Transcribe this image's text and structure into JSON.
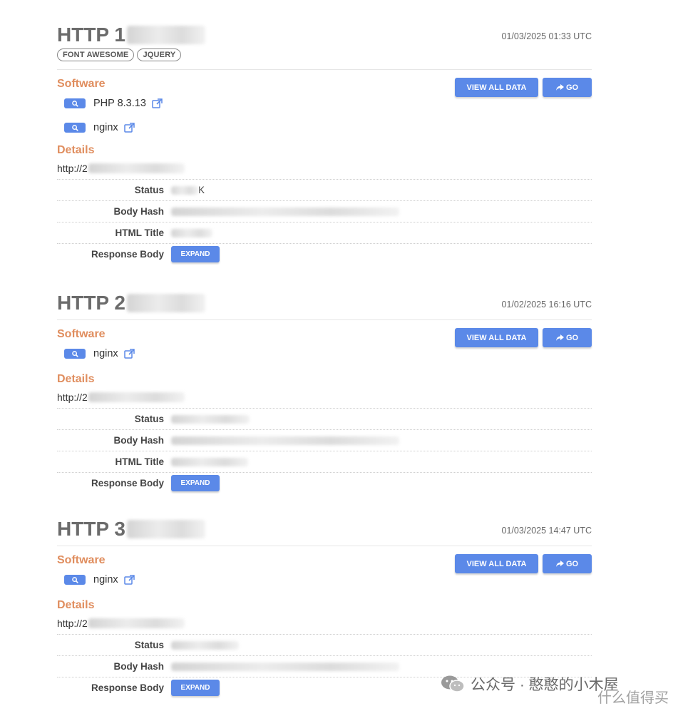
{
  "records": [
    {
      "title_prefix": "HTTP 1",
      "date": "01/03/2025 01:33 UTC",
      "tags": [
        "FONT AWESOME",
        "JQUERY"
      ],
      "software_heading": "Software",
      "software": [
        "PHP 8.3.13",
        "nginx"
      ],
      "details_heading": "Details",
      "url_prefix": "http://2",
      "status_suffix": "K",
      "has_title": true
    },
    {
      "title_prefix": "HTTP 2",
      "date": "01/02/2025 16:16 UTC",
      "software_heading": "Software",
      "software": [
        "nginx"
      ],
      "details_heading": "Details",
      "url_prefix": "http://2",
      "has_title": true
    },
    {
      "title_prefix": "HTTP 3",
      "date": "01/03/2025 14:47 UTC",
      "software_heading": "Software",
      "software": [
        "nginx"
      ],
      "details_heading": "Details",
      "url_prefix": "http://2",
      "has_title": false
    }
  ],
  "labels": {
    "view_all": "VIEW ALL DATA",
    "go": "GO",
    "status": "Status",
    "body_hash": "Body Hash",
    "html_title": "HTML Title",
    "response_body": "Response Body",
    "expand": "EXPAND"
  },
  "icons": {
    "search": "search-icon",
    "external": "external-link-icon",
    "share": "share-arrow-icon"
  },
  "colors": {
    "accent": "#e08e5f",
    "button": "#5b89e8",
    "title": "#6b6b6b"
  },
  "watermark": {
    "text": "公众号 · 憨憨的小木屋",
    "sub": "什么值得买"
  }
}
